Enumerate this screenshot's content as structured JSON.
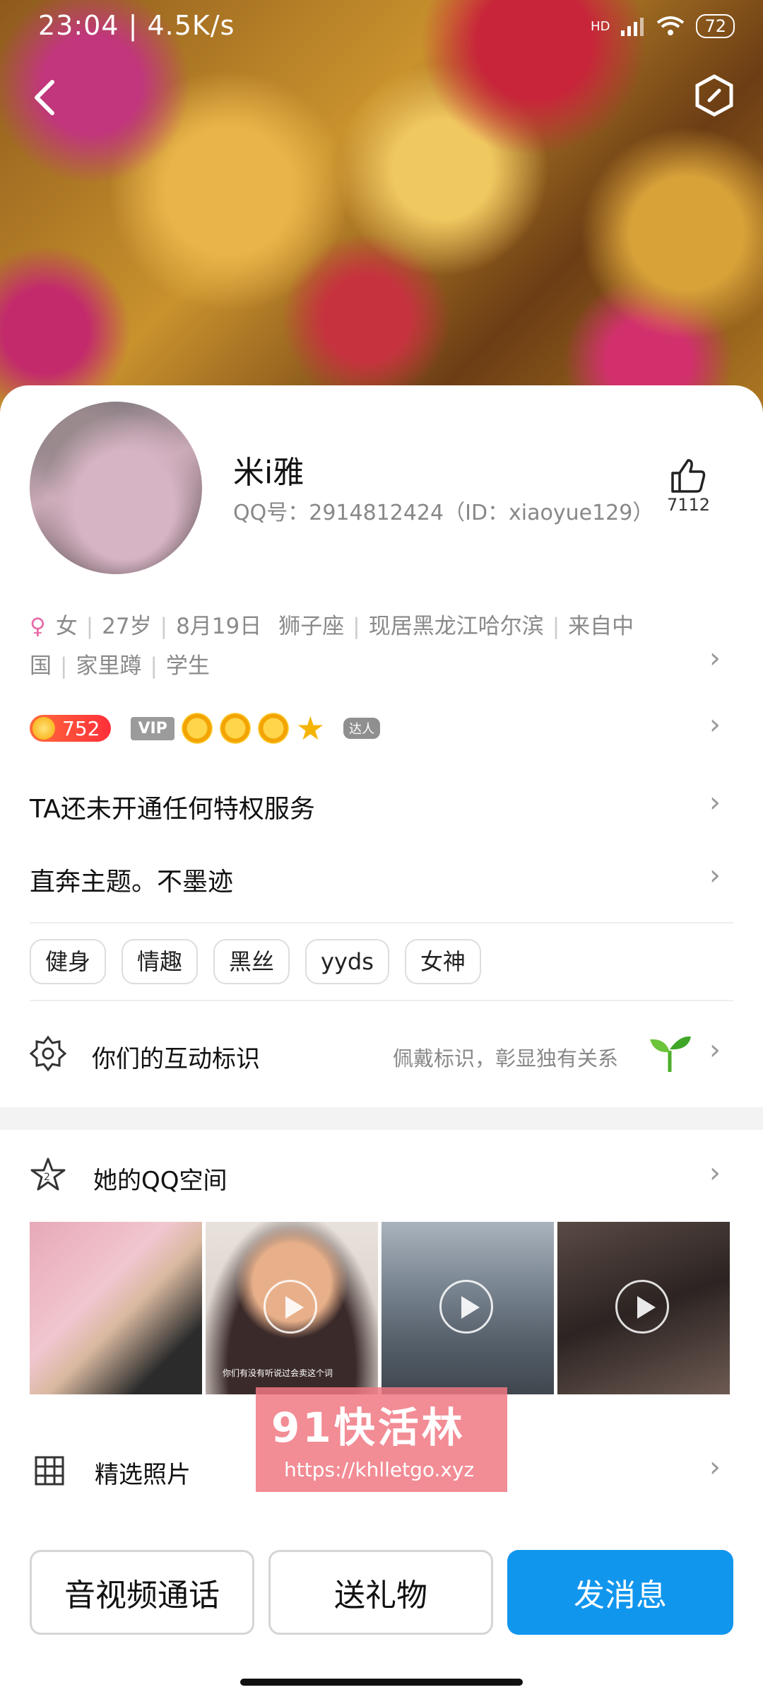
{
  "status_bar": {
    "time_speed": "23:04 | 4.5K/s",
    "network": "HD",
    "battery": "72"
  },
  "profile": {
    "name": "米i雅",
    "qq_line": "QQ号：2914812424（ID：xiaoyue129）",
    "like_count": "7112",
    "info_items": [
      "女",
      "27岁",
      "8月19日",
      "狮子座",
      "现居黑龙江哈尔滨",
      "来自中国",
      "家里蹲",
      "学生"
    ],
    "coin_value": "752",
    "vip_label": "VIP",
    "daren_label": "达人"
  },
  "rows": {
    "privilege": "TA还未开通任何特权服务",
    "signature": "直奔主题。不墨迹"
  },
  "tags": [
    "健身",
    "情趣",
    "黑丝",
    "yyds",
    "女神"
  ],
  "interaction": {
    "title": "你们的互动标识",
    "hint": "佩戴标识，彰显独有关系"
  },
  "qzone": {
    "title": "她的QQ空间",
    "caption": "你们有没有听说过会卖这个词"
  },
  "photos": {
    "title": "精选照片"
  },
  "watermark": {
    "brand": "91快活林",
    "url": "https://khlletgo.xyz"
  },
  "actions": {
    "call": "音视频通话",
    "gift": "送礼物",
    "message": "发消息"
  },
  "colors": {
    "primary": "#1196ee",
    "coin": "#ff2f3a",
    "sex_icon": "#e66aa8"
  }
}
